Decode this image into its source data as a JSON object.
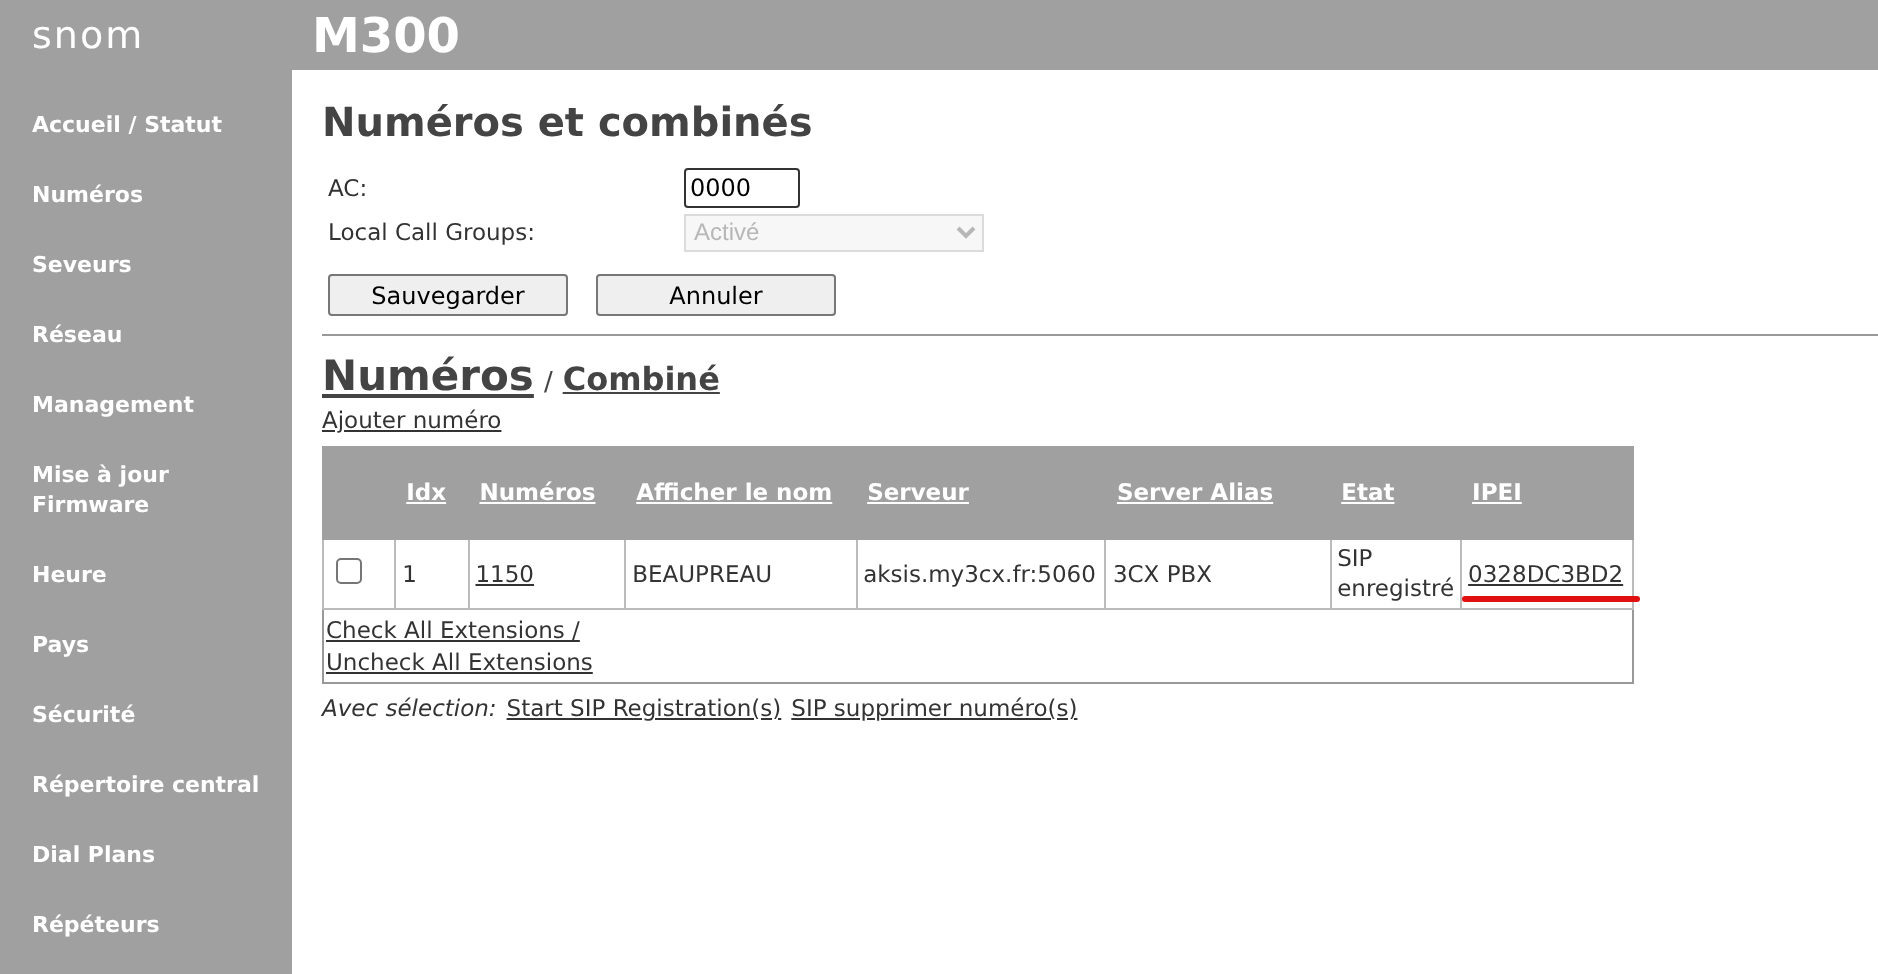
{
  "header": {
    "logo": "snom",
    "model": "M300"
  },
  "sidebar": {
    "items": [
      "Accueil / Statut",
      "Numéros",
      "Seveurs",
      "Réseau",
      "Management",
      "Mise à jour Firmware",
      "Heure",
      "Pays",
      "Sécurité",
      "Répertoire central",
      "Dial Plans",
      "Répéteurs"
    ]
  },
  "page_title": "Numéros et combinés",
  "form": {
    "fields": [
      {
        "kind": "input",
        "label": "AC:",
        "value": "0000",
        "disabled": false
      },
      {
        "kind": "select",
        "label": "Local Call Groups:",
        "value": "Activé",
        "disabled": true
      }
    ],
    "buttons": [
      "Sauvegarder",
      "Annuler"
    ]
  },
  "section_tabs": [
    {
      "label": "Numéros",
      "selected": true
    },
    {
      "label": "Combiné",
      "selected": false
    }
  ],
  "section_separator": "/",
  "add_link": "Ajouter numéro",
  "table": {
    "columns": [
      "Idx",
      "Numéros",
      "Afficher le nom",
      "Serveur",
      "Server Alias",
      "Etat",
      "IPEI"
    ],
    "rows": [
      {
        "checked": false,
        "cells": [
          "1",
          "1150",
          "BEAUPREAU",
          "aksis.my3cx.fr:5060",
          "3CX PBX",
          "SIP enregistré",
          "0328DC3BD2"
        ]
      }
    ],
    "footer_links": [
      "Check All Extensions /",
      "Uncheck All Extensions"
    ]
  },
  "selection": {
    "label": "Avec sélection:",
    "actions": [
      "Start SIP Registration(s)",
      "SIP supprimer numéro(s)"
    ]
  }
}
